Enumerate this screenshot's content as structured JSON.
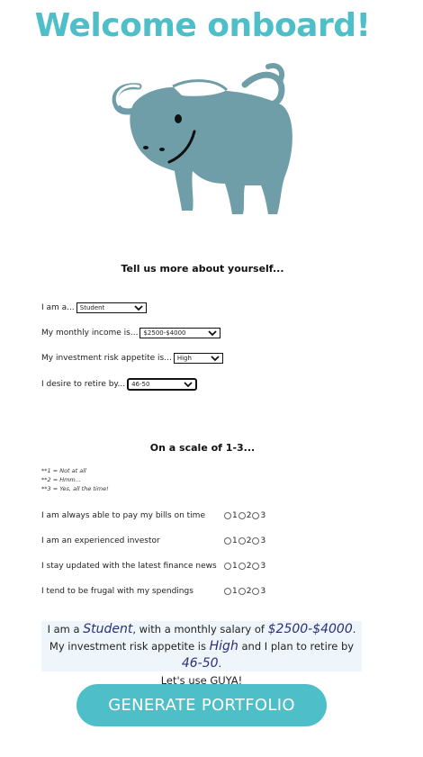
{
  "header": {
    "title": "Welcome onboard!"
  },
  "mascot": {
    "icon": "buffalo-icon",
    "color": "#6f9ea8"
  },
  "profile": {
    "heading": "Tell us more about yourself...",
    "role": {
      "label": "I am a...",
      "value": "Student"
    },
    "income": {
      "label": "My monthly income is...",
      "value": "$2500-$4000"
    },
    "risk": {
      "label": "My investment risk appetite is...",
      "value": "High"
    },
    "retire": {
      "label": "I desire to retire by...",
      "value": "46-50"
    }
  },
  "scale": {
    "heading": "On a scale of 1-3...",
    "legend": [
      "**1 = Not at all",
      "**2 = Hmm...",
      "**3 = Yes, all the time!"
    ],
    "options": [
      "1",
      "2",
      "3"
    ],
    "questions": [
      "I am always able to pay my bills on time",
      "I am an experienced investor",
      "I stay updated with the latest finance news",
      "I tend to be frugal with my spendings"
    ]
  },
  "summary": {
    "t1": "I am a ",
    "role": "Student",
    "t2": ", with a monthly salary of ",
    "income": "$2500-$4000",
    "t3": ". My investment risk appetite is ",
    "risk": "High",
    "t4": " and I plan to retire by ",
    "retire": "46-50",
    "t5": ".",
    "t6": "Let's use GUYA!"
  },
  "actions": {
    "generate_label": "GENERATE PORTFOLIO"
  },
  "colors": {
    "accent": "#4ebfc8",
    "highlight_text": "#2c2f7a",
    "summary_bg": "#eef6fb"
  }
}
